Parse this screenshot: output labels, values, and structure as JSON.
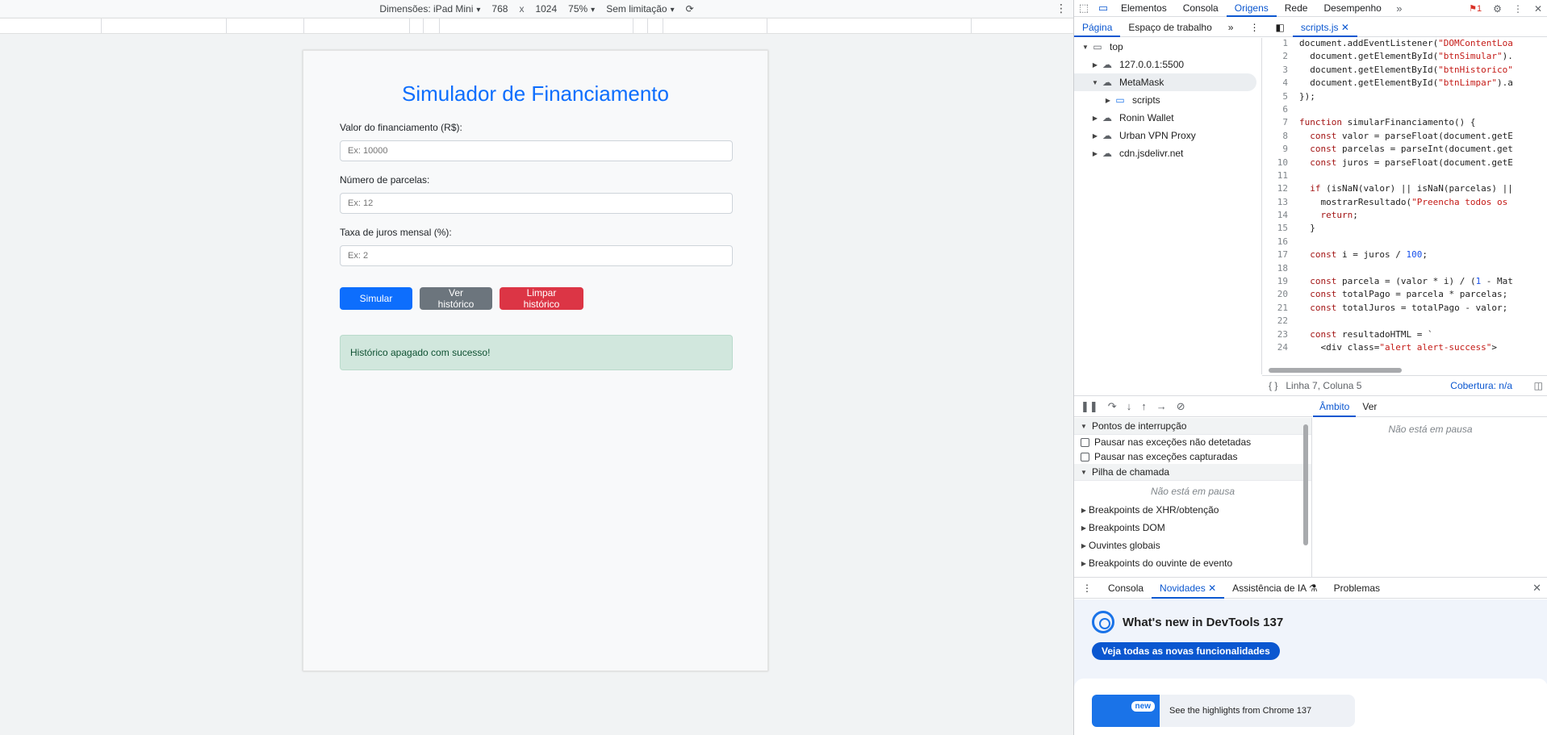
{
  "device_toolbar": {
    "dimensions_label": "Dimensões: iPad Mini",
    "width": "768",
    "times": "x",
    "height": "1024",
    "zoom": "75%",
    "throttle": "Sem limitação"
  },
  "page": {
    "title": "Simulador de Financiamento",
    "fields": [
      {
        "label": "Valor do financiamento (R$):",
        "placeholder": "Ex: 10000"
      },
      {
        "label": "Número de parcelas:",
        "placeholder": "Ex: 12"
      },
      {
        "label": "Taxa de juros mensal (%):",
        "placeholder": "Ex: 2"
      }
    ],
    "buttons": {
      "simulate": "Simular",
      "history": "Ver histórico",
      "clear": "Limpar histórico"
    },
    "alert": "Histórico apagado com sucesso!",
    "colors": {
      "primary": "#0d6efd",
      "secondary": "#6c757d",
      "danger": "#dc3545",
      "success_bg": "#d1e7dd"
    }
  },
  "devtools": {
    "main_tabs": [
      "Elementos",
      "Consola",
      "Origens",
      "Rede",
      "Desempenho"
    ],
    "active_tab": "Origens",
    "issues_count": "1",
    "sources_tabs": {
      "page": "Página",
      "workspace": "Espaço de trabalho",
      "file": "scripts.js"
    },
    "tree": [
      "top",
      "127.0.0.1:5500",
      "MetaMask",
      "scripts",
      "Ronin Wallet",
      "Urban VPN Proxy",
      "cdn.jsdelivr.net"
    ],
    "code_lines": [
      "document.addEventListener(\"DOMContentLoa",
      "  document.getElementById(\"btnSimular\").",
      "  document.getElementById(\"btnHistorico\"",
      "  document.getElementById(\"btnLimpar\").a",
      "});",
      "",
      "function simularFinanciamento() {",
      "  const valor = parseFloat(document.getE",
      "  const parcelas = parseInt(document.get",
      "  const juros = parseFloat(document.getE",
      "",
      "  if (isNaN(valor) || isNaN(parcelas) ||",
      "    mostrarResultado(\"Preencha todos os",
      "    return;",
      "  }",
      "",
      "  const i = juros / 100;",
      "",
      "  const parcela = (valor * i) / (1 - Mat",
      "  const totalPago = parcela * parcelas;",
      "  const totalJuros = totalPago - valor;",
      "",
      "  const resultadoHTML = `",
      "    <div class=\"alert alert-success\">"
    ],
    "status": {
      "position": "Linha 7, Coluna 5",
      "coverage": "Cobertura: n/a"
    },
    "debugger": {
      "breakpoints_header": "Pontos de interrupção",
      "pause_uncaught": "Pausar nas exceções não detetadas",
      "pause_caught": "Pausar nas exceções capturadas",
      "callstack_header": "Pilha de chamada",
      "not_paused": "Não está em pausa",
      "xhr": "Breakpoints de XHR/obtenção",
      "dom": "Breakpoints DOM",
      "global": "Ouvintes globais",
      "event": "Breakpoints do ouvinte de evento",
      "scope_tab": "Âmbito",
      "watch_tab": "Ver",
      "scope_not_paused": "Não está em pausa"
    },
    "drawer": {
      "tabs": [
        "Consola",
        "Novidades",
        "Assistência de IA",
        "Problemas"
      ],
      "active": "Novidades",
      "whatsnew_title": "What's new in DevTools 137",
      "whatsnew_button": "Veja todas as novas funcionalidades",
      "card_badge": "new",
      "card_text": "See the highlights from Chrome 137"
    }
  }
}
